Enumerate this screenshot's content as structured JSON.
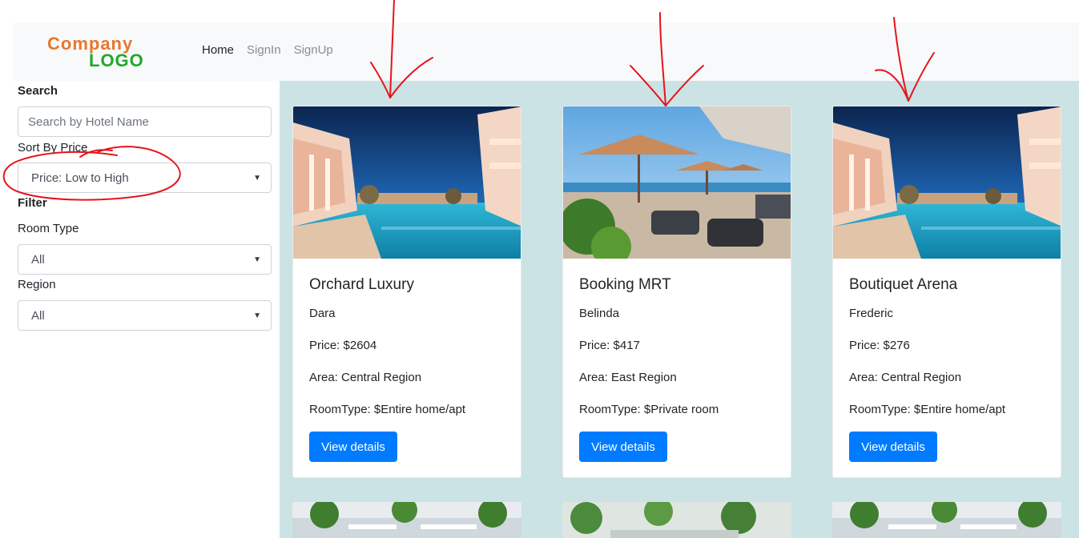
{
  "navbar": {
    "logo_line1": "Company",
    "logo_line2": "LOGO",
    "links": [
      {
        "label": "Home",
        "active": true
      },
      {
        "label": "SignIn",
        "active": false
      },
      {
        "label": "SignUp",
        "active": false
      }
    ]
  },
  "sidebar": {
    "search_heading": "Search",
    "search_placeholder": "Search by Hotel Name",
    "sort_label": "Sort By Price",
    "sort_value": "Price: Low to High",
    "filter_heading": "Filter",
    "room_type_label": "Room Type",
    "room_type_value": "All",
    "region_label": "Region",
    "region_value": "All"
  },
  "cards": [
    {
      "title": "Orchard Luxury",
      "host": "Dara",
      "price": "Price: $2604",
      "area": "Area: Central Region",
      "room_type": "RoomType: $Entire home/apt",
      "button": "View details",
      "image": "pool-night-icon"
    },
    {
      "title": "Booking MRT",
      "host": "Belinda",
      "price": "Price: $417",
      "area": "Area: East Region",
      "room_type": "RoomType: $Private room",
      "button": "View details",
      "image": "terrace-umbrellas-icon"
    },
    {
      "title": "Boutiquet Arena",
      "host": "Frederic",
      "price": "Price: $276",
      "area": "Area: Central Region",
      "room_type": "RoomType: $Entire home/apt",
      "button": "View details",
      "image": "pool-night-icon"
    }
  ],
  "colors": {
    "accent": "#007bff",
    "main_bg": "#cbe3e5",
    "navbar_bg": "#f8f9fa",
    "annotation": "#e8131b"
  }
}
